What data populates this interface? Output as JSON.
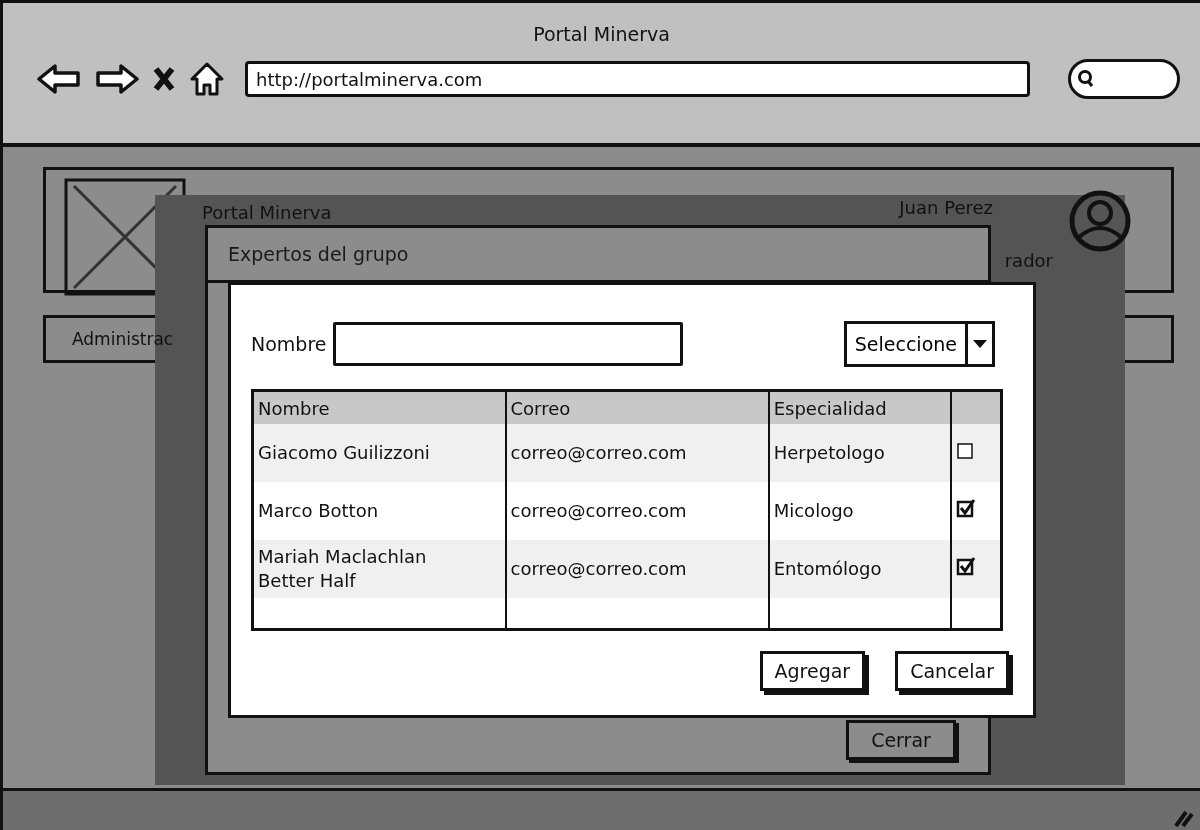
{
  "browser": {
    "title": "Portal Minerva",
    "url": "http://portalminerva.com"
  },
  "page": {
    "header": {
      "title": "Portal Minerva",
      "user_name": "Juan Perez",
      "user_role": "rador"
    },
    "nav": {
      "label": "Administrac"
    }
  },
  "dialog": {
    "title": "Expertos del grupo",
    "close_button": "Cerrar"
  },
  "add_dialog": {
    "name_label": "Nombre",
    "select": "Seleccione",
    "table": {
      "columns": [
        "Nombre",
        "Correo",
        "Especialidad"
      ],
      "rows": [
        {
          "name": "Giacomo Guilizzoni",
          "email": "correo@correo.com",
          "specialty": "Herpetologo",
          "checked": false
        },
        {
          "name": "Marco Botton",
          "email": "correo@correo.com",
          "specialty": "Micologo",
          "checked": true
        },
        {
          "name": "Mariah Maclachlan\nBetter Half",
          "email": "correo@correo.com",
          "specialty": "Entomólogo",
          "checked": true
        }
      ]
    },
    "buttons": [
      "Agregar",
      "Cancelar"
    ]
  }
}
